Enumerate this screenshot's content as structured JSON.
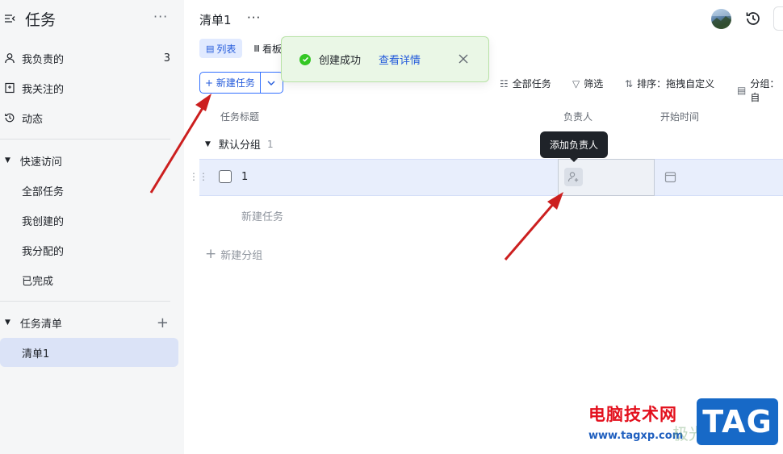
{
  "sidebar": {
    "title": "任务",
    "more": "···",
    "items": [
      {
        "label": "我负责的",
        "count": "3"
      },
      {
        "label": "我关注的"
      },
      {
        "label": "动态"
      }
    ],
    "quick_access": {
      "label": "快速访问",
      "items": [
        "全部任务",
        "我创建的",
        "我分配的",
        "已完成"
      ]
    },
    "task_lists": {
      "label": "任务清单",
      "items": [
        "清单1"
      ]
    }
  },
  "header": {
    "title": "清单1",
    "more": "···"
  },
  "view_tabs": [
    {
      "label": "列表",
      "active": true
    },
    {
      "label": "看板"
    }
  ],
  "toolbar": {
    "new_task": "+ 新建任务",
    "all_tasks": "全部任务",
    "filter": "筛选",
    "sort": "排序：拖拽自定义",
    "group": "分组：自"
  },
  "table": {
    "columns": [
      "任务标题",
      "负责人",
      "开始时间"
    ],
    "group": {
      "label": "默认分组",
      "count": "1"
    },
    "rows": [
      {
        "title": "1"
      }
    ],
    "new_task": "新建任务",
    "new_group": "新建分组"
  },
  "tooltip": "添加负责人",
  "toast": {
    "message": "创建成功",
    "link": "查看详情"
  },
  "watermark": {
    "site_name": "电脑技术网",
    "url": "www.tagxp.com",
    "badge": "TAG",
    "faint": "极光下载站"
  },
  "colors": {
    "accent": "#3370ff",
    "row_highlight": "#e8eefc",
    "sidebar_bg": "#f5f6f7",
    "toast_bg": "#eaf7e6",
    "success": "#34c724",
    "annotation_arrow": "#cc1f1f"
  }
}
